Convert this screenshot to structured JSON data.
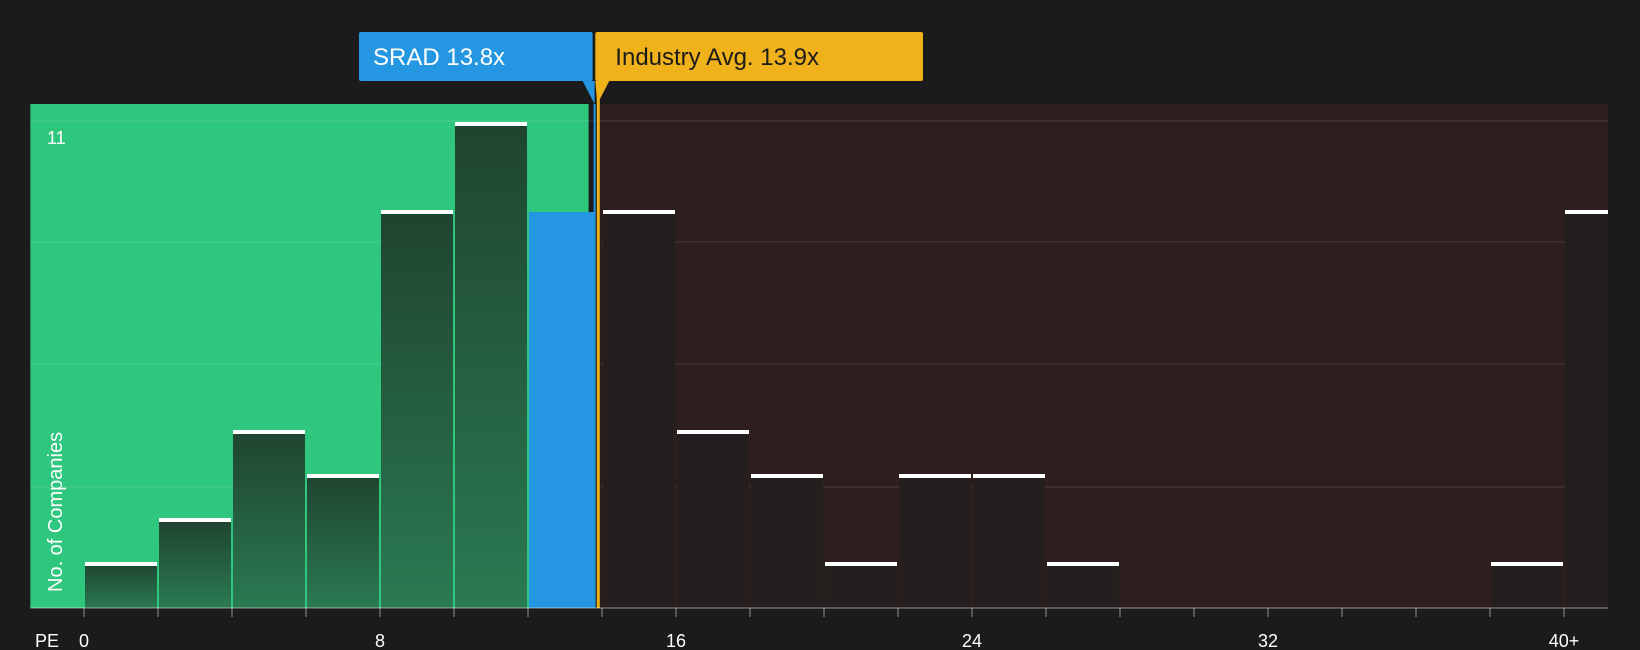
{
  "chart_data": {
    "type": "bar",
    "xlabel": "PE",
    "ylabel": "No. of Companies",
    "bin_width": 2,
    "bins_start": [
      0,
      2,
      4,
      6,
      8,
      10,
      12,
      14,
      16,
      18,
      20,
      22,
      24,
      26,
      28,
      30,
      32,
      34,
      36,
      38,
      40
    ],
    "values": [
      1,
      2,
      4,
      3,
      9,
      11,
      9,
      9,
      4,
      3,
      1,
      3,
      3,
      1,
      0,
      0,
      0,
      0,
      0,
      1,
      9
    ],
    "x_ticks": [
      "0",
      "8",
      "16",
      "24",
      "32",
      "40+"
    ],
    "x_tick_values": [
      0,
      8,
      16,
      24,
      32,
      40
    ],
    "y_tick_label": "11",
    "ylim": [
      0,
      11
    ],
    "xlim": [
      -1.45,
      41.05
    ],
    "grid": true,
    "colors": {
      "below_region": "#2fc77e",
      "above_region": "#2e1e1e",
      "company_bar": "#2596e1",
      "industry_line": "#f0b21b",
      "cap": "#ffffff",
      "background": "#1b1b1b"
    },
    "annotations": {
      "company": {
        "label": "SRAD 13.8x",
        "value": 13.8
      },
      "industry": {
        "label": "Industry Avg. 13.9x",
        "value": 13.9
      }
    }
  }
}
